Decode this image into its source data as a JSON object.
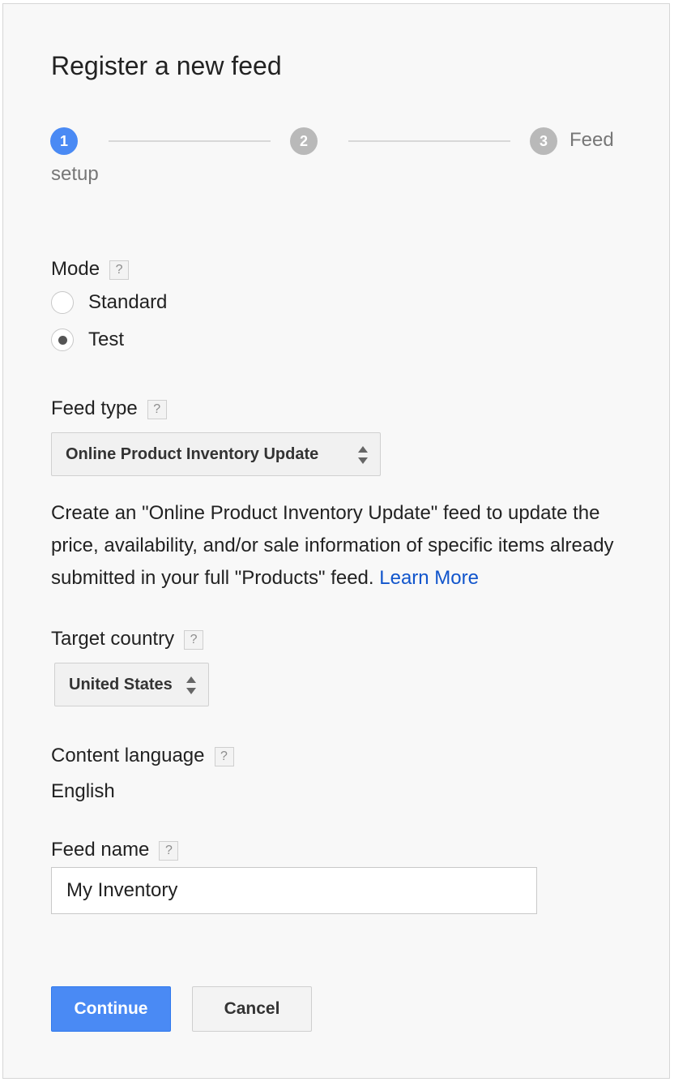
{
  "dialog": {
    "title": "Register a new feed"
  },
  "stepper": {
    "steps": [
      {
        "number": "1",
        "label": "setup",
        "state": "active"
      },
      {
        "number": "2",
        "label": "",
        "state": "inactive"
      },
      {
        "number": "3",
        "label": "Feed",
        "state": "inactive"
      }
    ],
    "active_color": "#4a8af4",
    "inactive_color": "#b9b9b9"
  },
  "mode": {
    "label": "Mode",
    "help": "?",
    "options": [
      {
        "label": "Standard",
        "checked": false
      },
      {
        "label": "Test",
        "checked": true
      }
    ]
  },
  "feed_type": {
    "label": "Feed type",
    "help": "?",
    "selected": "Online Product Inventory Update",
    "description": "Create an \"Online Product Inventory Update\" feed to update the price, availability, and/or sale information of specific items already submitted in your full \"Products\" feed.",
    "learn_more": "Learn More"
  },
  "target_country": {
    "label": "Target country",
    "help": "?",
    "selected": "United States"
  },
  "content_language": {
    "label": "Content language",
    "help": "?",
    "value": "English"
  },
  "feed_name": {
    "label": "Feed name",
    "help": "?",
    "value": "My Inventory"
  },
  "actions": {
    "continue_label": "Continue",
    "cancel_label": "Cancel"
  },
  "colors": {
    "primary": "#4a8af4",
    "link": "#1155cc",
    "background": "#f8f8f8"
  },
  "icons": {
    "help": "question-mark-icon",
    "select_arrows": "up-down-arrows-icon"
  }
}
